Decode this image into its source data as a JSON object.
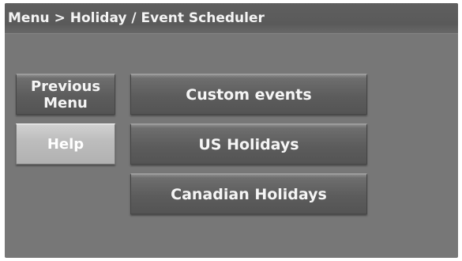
{
  "breadcrumb": "Menu > Holiday / Event Scheduler",
  "sidebar": {
    "previous_menu": [
      "Previous",
      "Menu"
    ],
    "help": "Help"
  },
  "main": {
    "options": [
      "Custom events",
      "US Holidays",
      "Canadian Holidays"
    ]
  }
}
